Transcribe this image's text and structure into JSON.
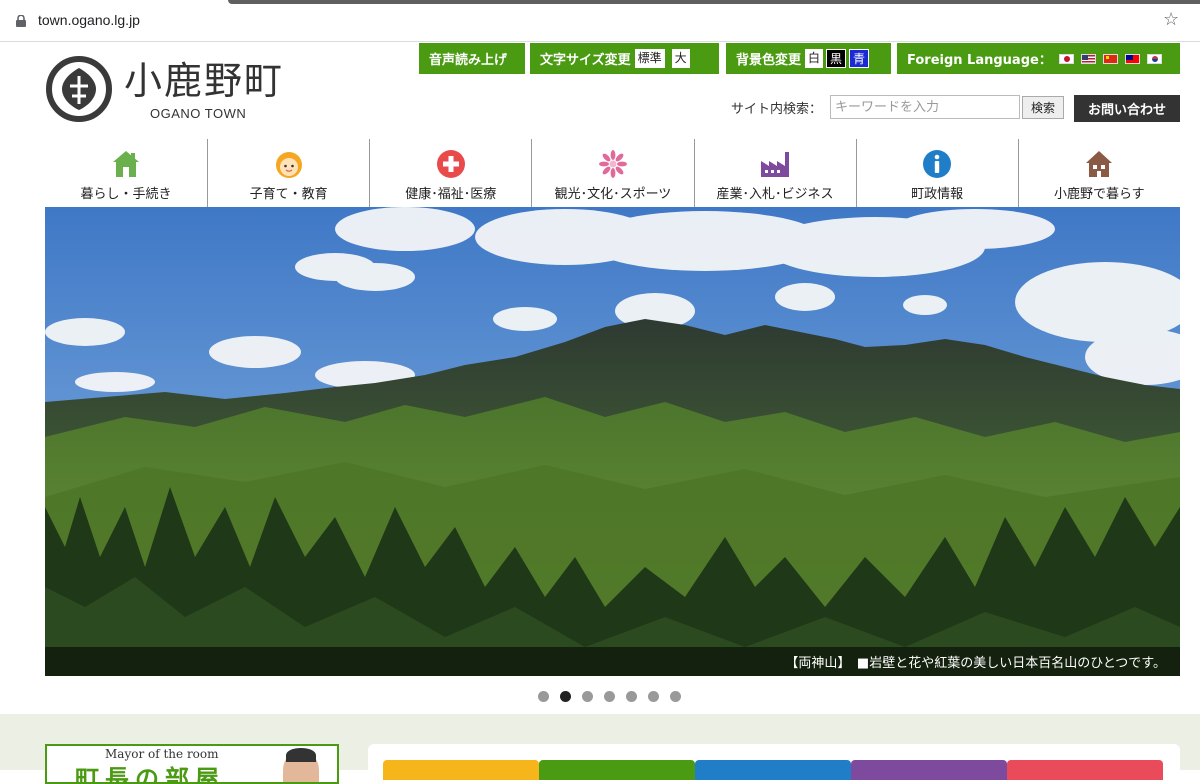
{
  "browser": {
    "url": "town.ogano.lg.jp"
  },
  "utility": {
    "read_aloud": "音声読み上げ",
    "font_size_label": "文字サイズ変更",
    "font_size_normal": "標準",
    "font_size_large": "大",
    "bg_color_label": "背景色変更",
    "bg_white": "白",
    "bg_black": "黒",
    "bg_blue": "青",
    "foreign_language": "Foreign Language："
  },
  "logo": {
    "title": "小鹿野町",
    "subtitle": "OGANO TOWN"
  },
  "search": {
    "label": "サイト内検索：",
    "placeholder": "キーワードを入力",
    "button": "検索"
  },
  "contact_button": "お問い合わせ",
  "nav": {
    "items": [
      {
        "label": "暮らし・手続き",
        "icon": "house-icon",
        "color": "#6ab04c"
      },
      {
        "label": "子育て・教育",
        "icon": "child-face-icon",
        "color": "#f5a623"
      },
      {
        "label": "健康･福祉･医療",
        "icon": "medical-cross-icon",
        "color": "#e94b4b"
      },
      {
        "label": "観光･文化･スポーツ",
        "icon": "flower-icon",
        "color": "#e06a9a"
      },
      {
        "label": "産業･入札･ビジネス",
        "icon": "factory-icon",
        "color": "#7d4a9e"
      },
      {
        "label": "町政情報",
        "icon": "info-icon",
        "color": "#1f7ec7"
      },
      {
        "label": "小鹿野で暮らす",
        "icon": "home-icon",
        "color": "#8a5a44"
      }
    ]
  },
  "hero": {
    "caption": "【両神山】　■岩壁と花や紅葉の美しい日本百名山のひとつです。",
    "slide_count": 7,
    "active_slide": 2
  },
  "mayor": {
    "en": "Mayor of the room",
    "jp": "町長の部屋"
  },
  "colors": {
    "accent_green": "#4a9a12",
    "dark": "#333333"
  }
}
